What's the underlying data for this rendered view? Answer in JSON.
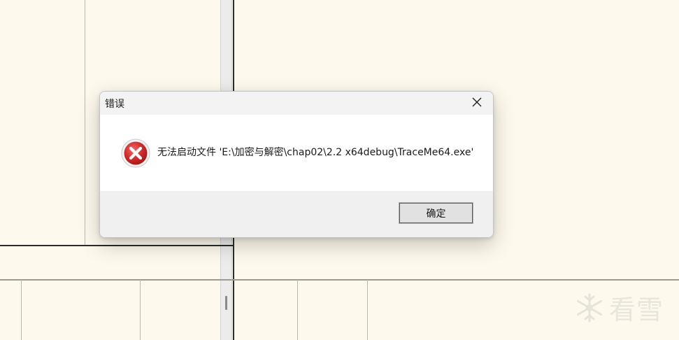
{
  "dialog": {
    "title": "错误",
    "message": "无法启动文件 'E:\\加密与解密\\chap02\\2.2 x64debug\\TraceMe64.exe'",
    "ok_label": "确定",
    "icon": "error-icon",
    "close_icon": "close-icon"
  },
  "watermark": {
    "text": "看雪",
    "icon": "snowflake-logo-icon"
  },
  "colors": {
    "background": "#fdf9ec",
    "dialog_body": "#ffffff",
    "dialog_footer": "#f0f0f0",
    "error_red": "#d42b2b"
  }
}
